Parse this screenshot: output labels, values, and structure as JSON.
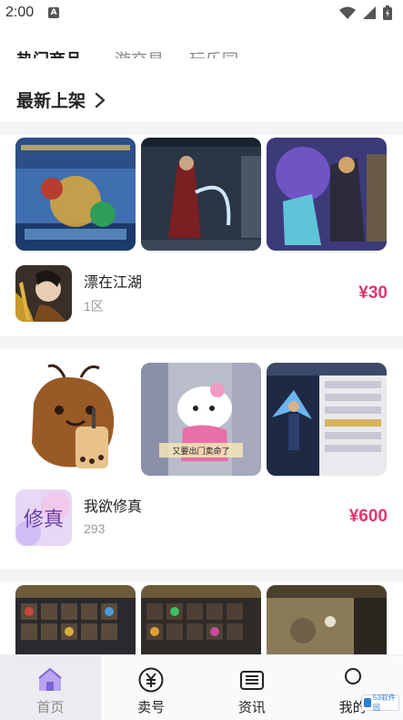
{
  "status_bar": {
    "time": "2:00",
    "indicator": "A"
  },
  "top_tabs": [
    {
      "label": "热门商品",
      "active": true
    },
    {
      "label": "游交易",
      "active": false
    },
    {
      "label": "玩乐园",
      "active": false
    }
  ],
  "section": {
    "title": "最新上架"
  },
  "listings": [
    {
      "name": "漂在江湖",
      "subtitle": "1区",
      "price": "¥30"
    },
    {
      "name": "我欲修真",
      "subtitle": "293",
      "price": "¥600"
    }
  ],
  "thumb_captions": {
    "cat_meme": "又要出门卖命了"
  },
  "icon_text": {
    "xiuzhen_logo": "修真"
  },
  "bottom_nav": [
    {
      "label": "首页",
      "icon": "home-icon",
      "active": true
    },
    {
      "label": "卖号",
      "icon": "yen-icon",
      "active": false
    },
    {
      "label": "资讯",
      "icon": "news-icon",
      "active": false
    },
    {
      "label": "我的",
      "icon": "profile-icon",
      "active": false
    }
  ],
  "watermark": {
    "text": "53软件园"
  },
  "colors": {
    "price": "#e8336b",
    "nav_active_bg": "#ececf0",
    "home_icon": "#7b63d9"
  }
}
